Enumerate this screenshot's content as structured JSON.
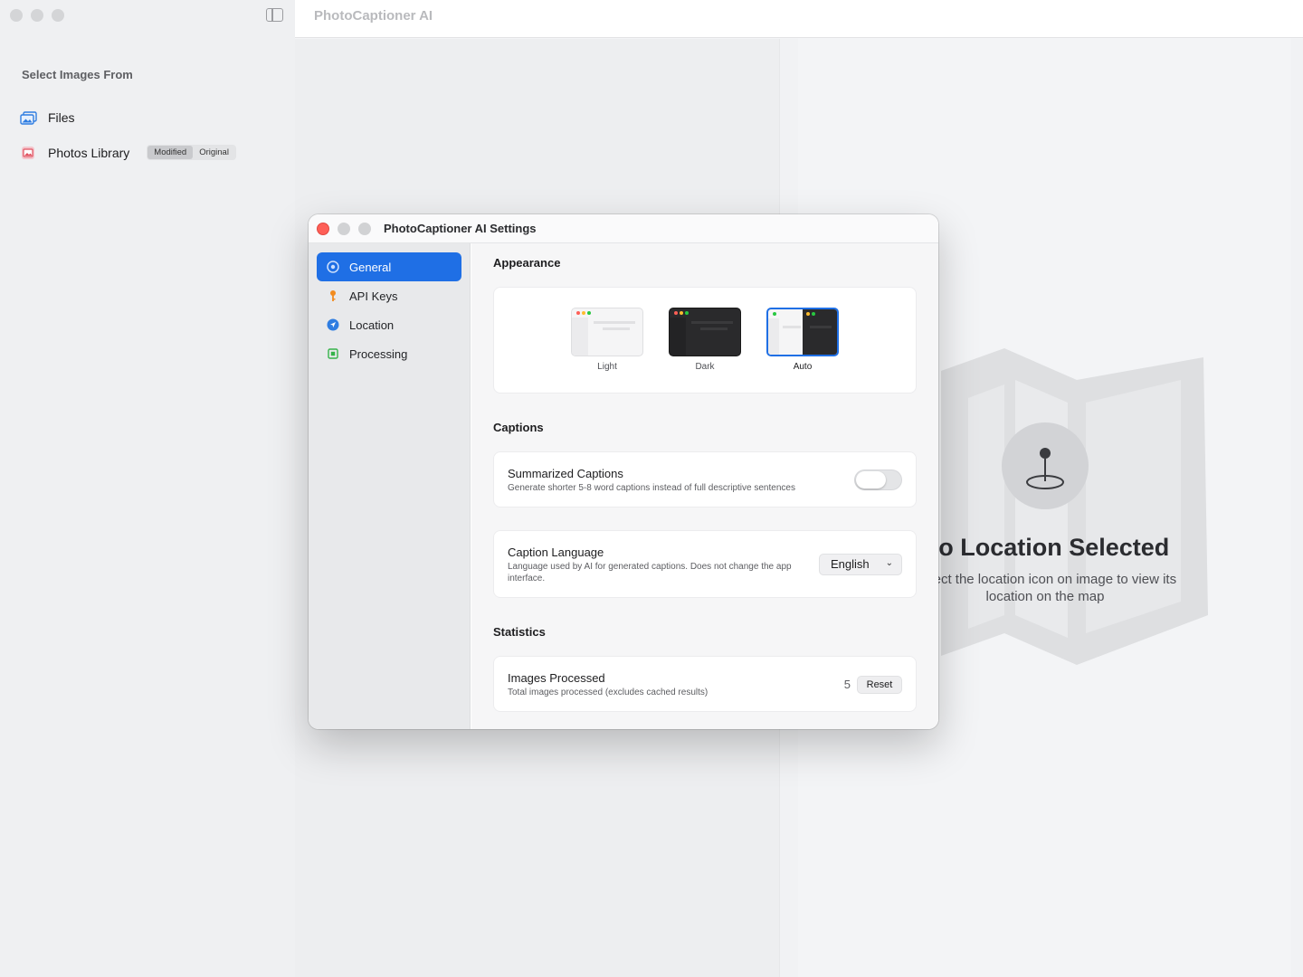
{
  "main": {
    "app_title": "PhotoCaptioner AI",
    "sidebar": {
      "heading": "Select Images From",
      "items": [
        {
          "label": "Files",
          "icon": "photo-stack-icon"
        },
        {
          "label": "Photos Library",
          "icon": "photos-app-icon"
        }
      ],
      "photos_segments": [
        "Modified",
        "Original"
      ],
      "photos_selected_segment": "Modified"
    },
    "empty_state": {
      "title": "No Location Selected",
      "subtitle": "Select the location icon on image to view its location on the map"
    }
  },
  "settings": {
    "window_title": "PhotoCaptioner AI Settings",
    "nav": [
      {
        "label": "General",
        "icon": "gear-icon",
        "active": true
      },
      {
        "label": "API Keys",
        "icon": "key-icon",
        "active": false
      },
      {
        "label": "Location",
        "icon": "location-arrow-icon",
        "active": false
      },
      {
        "label": "Processing",
        "icon": "chip-icon",
        "active": false
      }
    ],
    "appearance": {
      "title": "Appearance",
      "options": [
        "Light",
        "Dark",
        "Auto"
      ],
      "selected": "Auto"
    },
    "captions": {
      "title": "Captions",
      "summarized": {
        "label": "Summarized Captions",
        "description": "Generate shorter 5-8 word captions instead of full descriptive sentences",
        "enabled": false
      },
      "language": {
        "label": "Caption Language",
        "description": "Language used by AI for generated captions. Does not change the app interface.",
        "value": "English"
      }
    },
    "statistics": {
      "title": "Statistics",
      "images_processed": {
        "label": "Images Processed",
        "description": "Total images processed (excludes cached results)",
        "value": "5",
        "reset_label": "Reset"
      }
    }
  },
  "colors": {
    "accent": "#1f6fe5",
    "close": "#fe5f57"
  }
}
